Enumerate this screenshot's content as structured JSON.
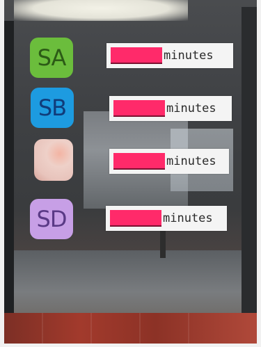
{
  "badges": [
    {
      "text": "SA",
      "color": "#6bbd3c"
    },
    {
      "text": "SB",
      "color": "#1d9be0"
    },
    {
      "text": "",
      "color": "#f3b4a3"
    },
    {
      "text": "SD",
      "color": "#c79fe6"
    }
  ],
  "rows": [
    {
      "blank_color": "#ff2a6a",
      "unit": "minutes"
    },
    {
      "blank_color": "#ff2a6a",
      "unit": "minutes"
    },
    {
      "blank_color": "#ff2a6a",
      "unit": "minutes"
    },
    {
      "blank_color": "#ff2a6a",
      "unit": "minutes"
    }
  ]
}
